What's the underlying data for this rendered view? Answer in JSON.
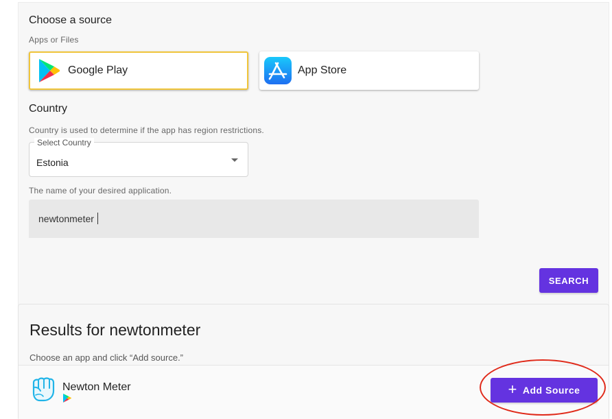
{
  "source_section": {
    "title": "Choose a source",
    "subtitle": "Apps or Files",
    "options": [
      {
        "label": "Google Play",
        "icon": "google-play-icon",
        "selected": true
      },
      {
        "label": "App Store",
        "icon": "app-store-icon",
        "selected": false
      }
    ]
  },
  "country_section": {
    "title": "Country",
    "caption": "Country is used to determine if the app has region restrictions.",
    "select_label": "Select Country",
    "select_value": "Estonia"
  },
  "app_search": {
    "caption": "The name of your desired application.",
    "value": "newtonmeter",
    "search_button": "SEARCH"
  },
  "results": {
    "title": "Results for newtonmeter",
    "subtitle": "Choose an app and click “Add source.”",
    "items": [
      {
        "name": "Newton Meter",
        "icon": "fist-app-icon",
        "store_icon": "google-play-icon",
        "action": "Add Source"
      }
    ]
  },
  "colors": {
    "accent": "#6433e0",
    "selected_border": "#f0c53a",
    "highlight": "#e02a1a"
  }
}
